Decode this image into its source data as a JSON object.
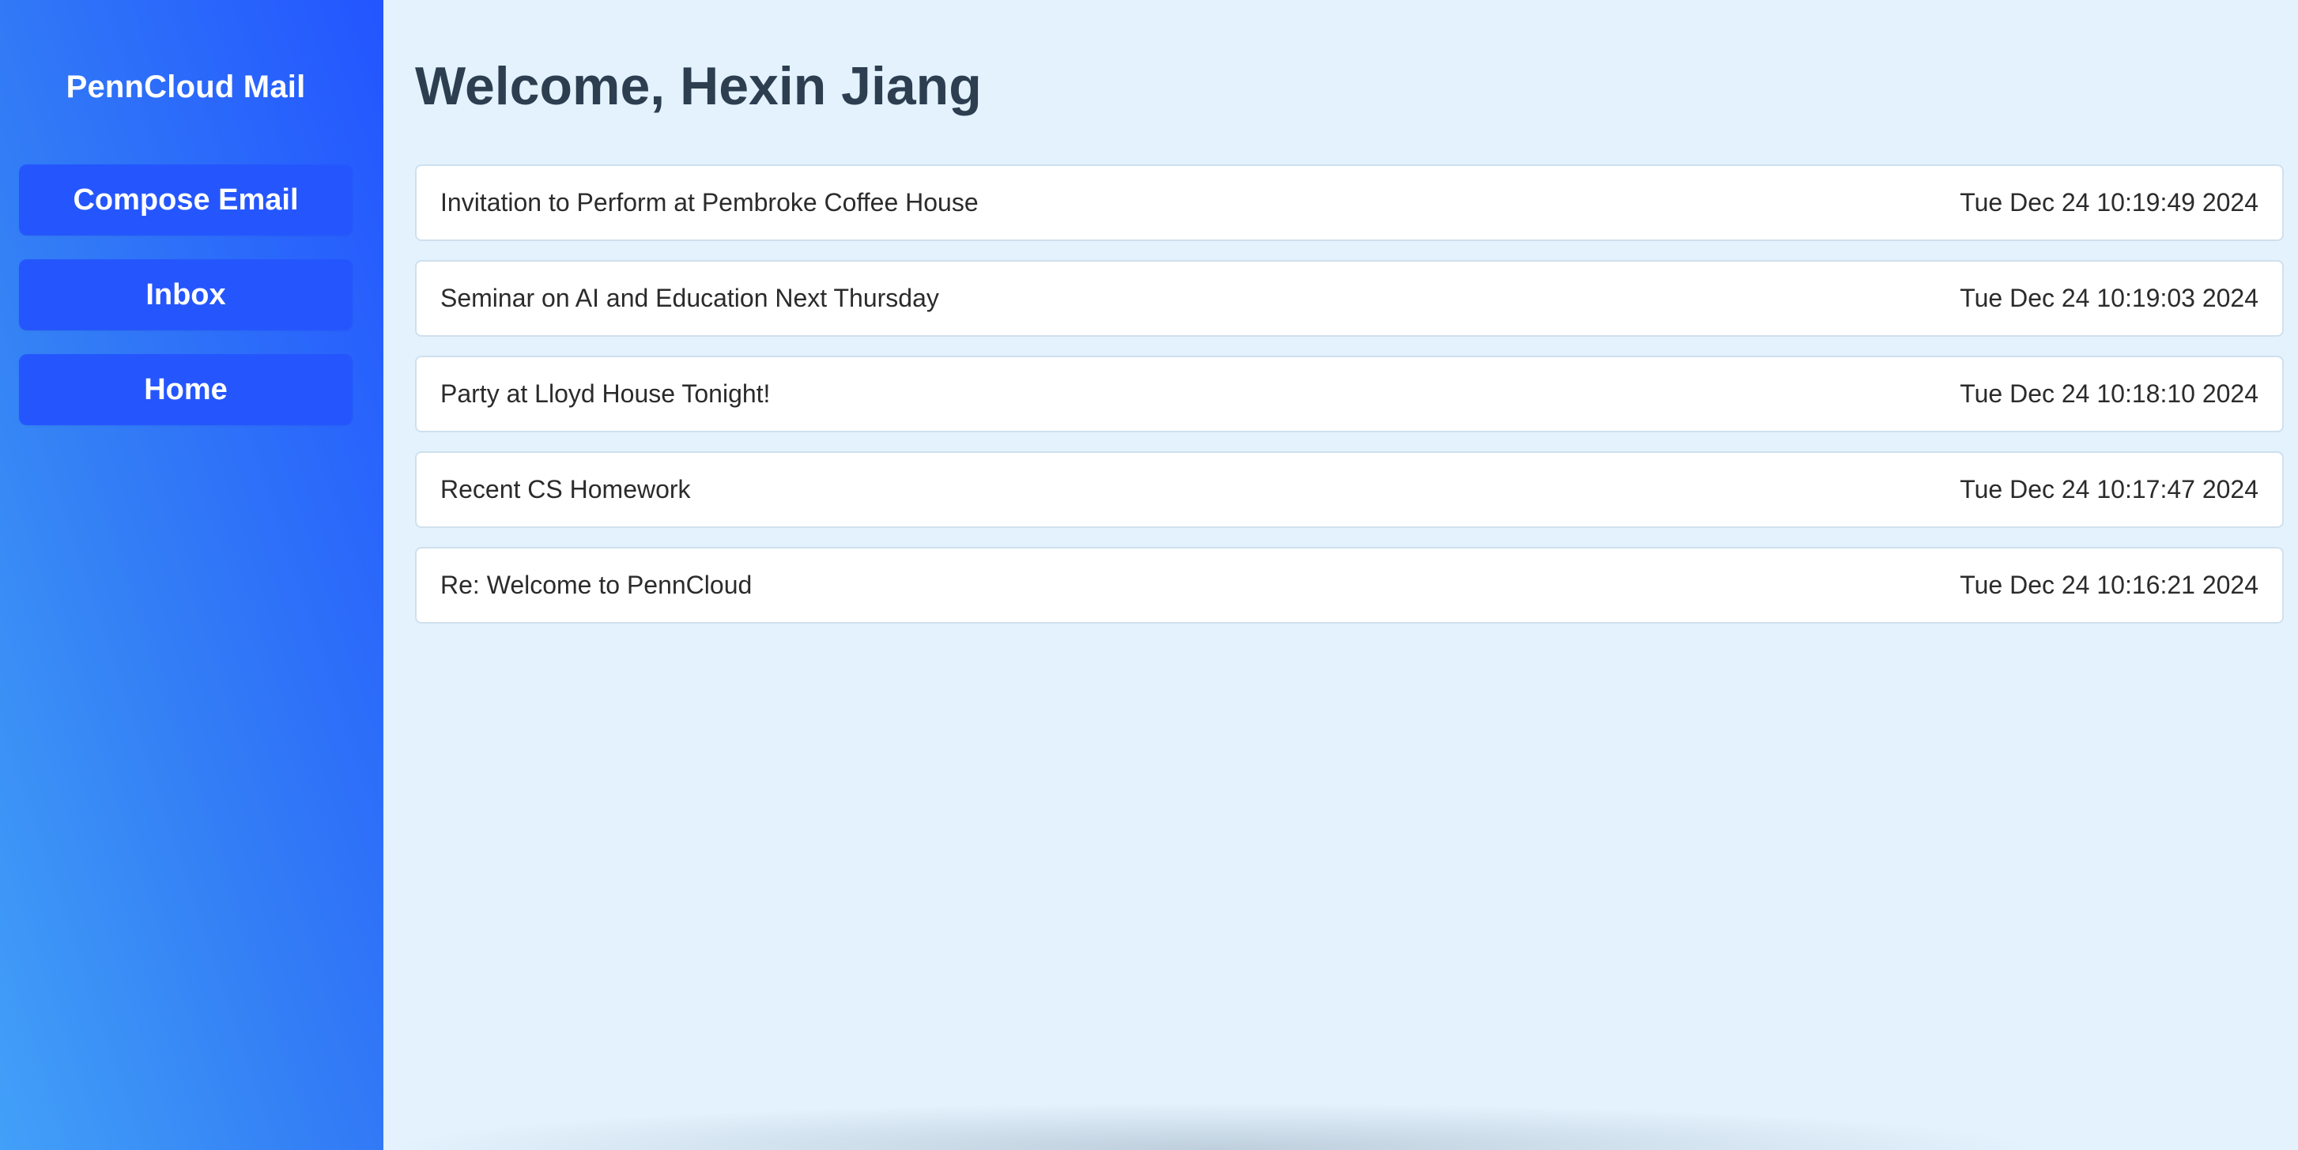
{
  "sidebar": {
    "title": "PennCloud Mail",
    "buttons": {
      "compose": "Compose Email",
      "inbox": "Inbox",
      "home": "Home"
    }
  },
  "main": {
    "welcome": "Welcome, Hexin Jiang",
    "emails": [
      {
        "subject": "Invitation to Perform at Pembroke Coffee House",
        "date": "Tue Dec 24 10:19:49 2024"
      },
      {
        "subject": "Seminar on AI and Education Next Thursday",
        "date": "Tue Dec 24 10:19:03 2024"
      },
      {
        "subject": "Party at Lloyd House Tonight!",
        "date": "Tue Dec 24 10:18:10 2024"
      },
      {
        "subject": "Recent CS Homework",
        "date": "Tue Dec 24 10:17:47 2024"
      },
      {
        "subject": "Re: Welcome to PennCloud",
        "date": "Tue Dec 24 10:16:21 2024"
      }
    ]
  },
  "colors": {
    "sidebar_gradient_start": "#42a0f8",
    "sidebar_gradient_end": "#2355ff",
    "nav_button": "#2556fd",
    "main_background": "#e3f2fd",
    "heading_text": "#2c3e50"
  }
}
